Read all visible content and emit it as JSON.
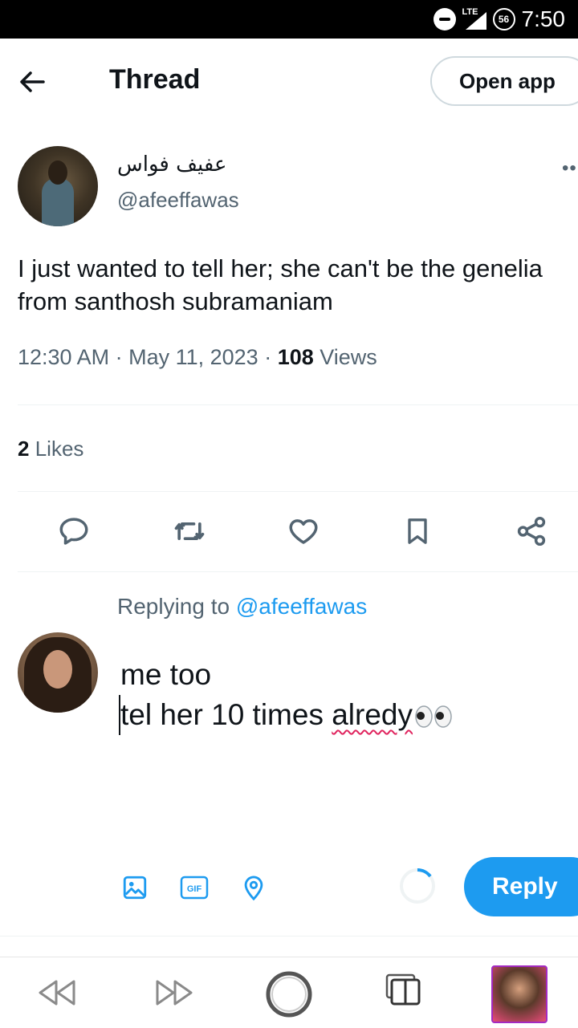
{
  "status_bar": {
    "network": "LTE",
    "badge": "56",
    "time": "7:50"
  },
  "header": {
    "title": "Thread",
    "open_app_label": "Open app"
  },
  "tweet": {
    "display_name": "عفيف فواس",
    "handle": "@afeeffawas",
    "text": "I just wanted to tell her; she can't be the genelia from santhosh subramaniam",
    "time": "12:30 AM",
    "date": "May 11, 2023",
    "views_count": "108",
    "views_label": "Views",
    "likes_count": "2",
    "likes_label": "Likes"
  },
  "reply": {
    "replying_prefix": "Replying to",
    "replying_to": "@afeeffawas",
    "draft_line1": "me too",
    "draft_line2_plain": "tel her 10 times ",
    "draft_line2_misspelled": "alredy"
  },
  "composer": {
    "reply_button_label": "Reply",
    "gif_label": "GIF"
  },
  "icons": {
    "reply": "reply-icon",
    "retweet": "retweet-icon",
    "like": "heart-icon",
    "bookmark": "bookmark-icon",
    "share": "share-icon"
  },
  "colors": {
    "accent": "#1d9bf0",
    "text_primary": "#0f1419",
    "text_secondary": "#536471"
  }
}
